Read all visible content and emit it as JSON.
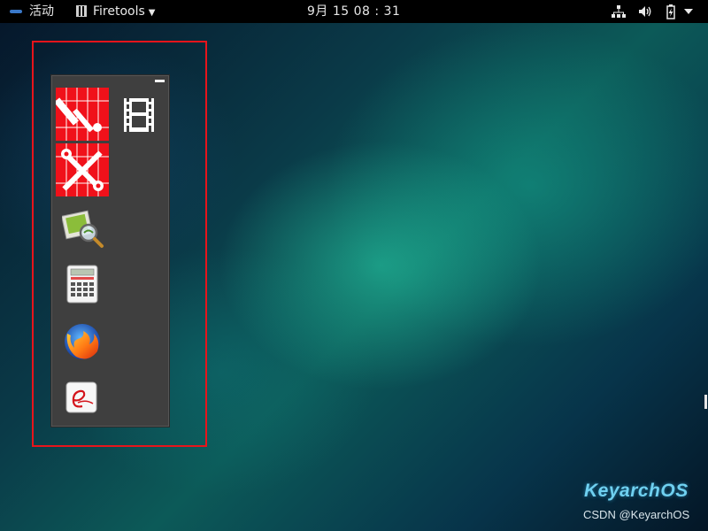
{
  "topbar": {
    "activities_label": "活动",
    "app_menu_label": "Firetools",
    "clock": "9月 15 08 : 31"
  },
  "dock": {
    "items": [
      {
        "icon": "firetools-config-icon"
      },
      {
        "icon": "video-player-icon"
      },
      {
        "icon": "firejail-tools-icon"
      },
      {
        "icon": "image-viewer-icon"
      },
      {
        "icon": "calculator-icon"
      },
      {
        "icon": "firefox-icon"
      },
      {
        "icon": "e-app-icon"
      }
    ]
  },
  "watermark": {
    "brand": "KeyarchOS",
    "credit": "CSDN @KeyarchOS"
  },
  "colors": {
    "highlight": "#e8141b",
    "dock_bg": "#3f3f3f",
    "topbar_bg": "#000000"
  }
}
